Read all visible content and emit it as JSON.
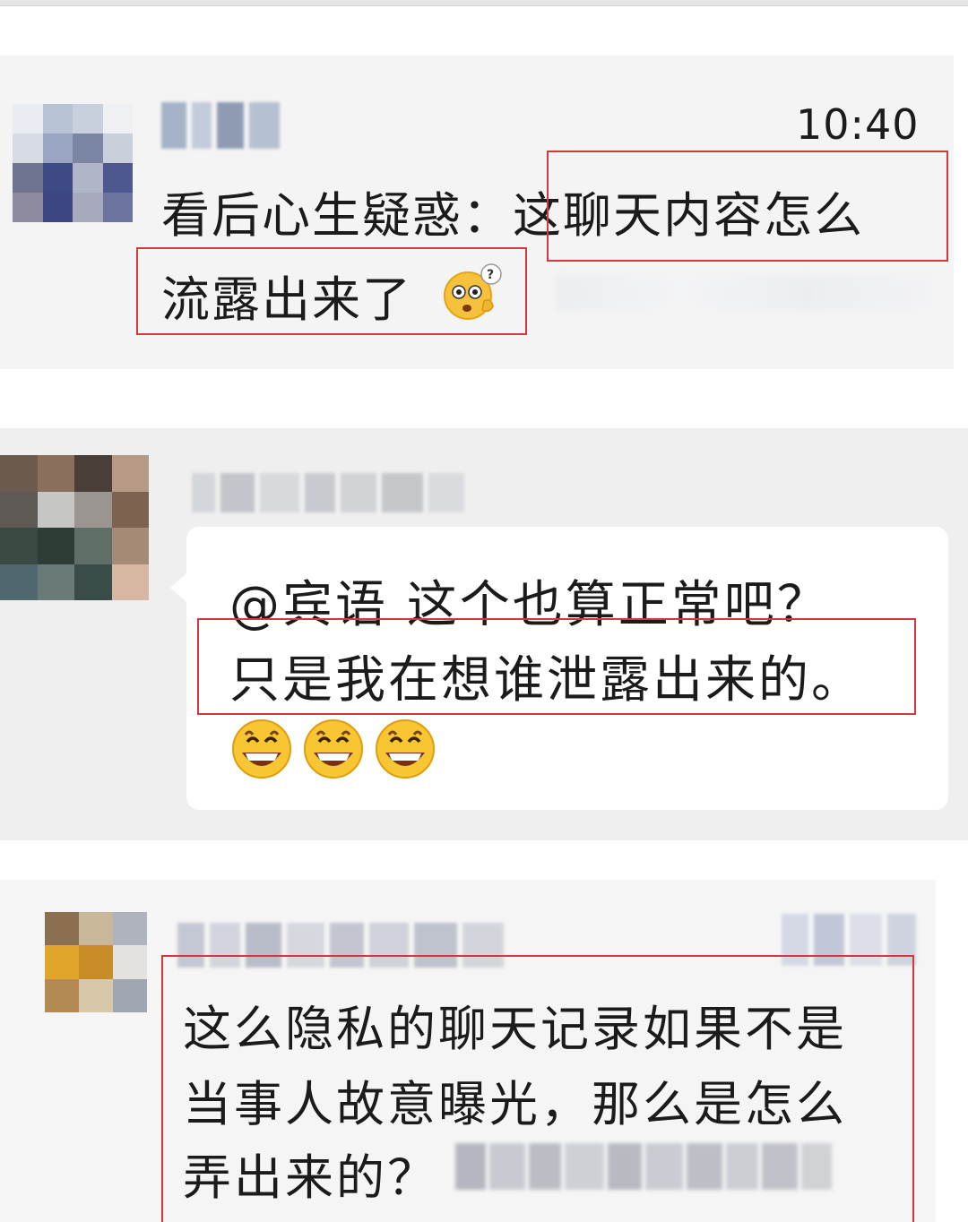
{
  "message_1": {
    "time": "10:40",
    "line1": "看后心生疑惑：这聊天内容怎么",
    "line2": "流露出来了",
    "emoji": "puzzled-face-icon"
  },
  "message_2": {
    "line1": "@宾语  这个也算正常吧？",
    "line2": "只是我在想谁泄露出来的。",
    "emoji": [
      "grinning-face-icon",
      "grinning-face-icon",
      "grinning-face-icon"
    ]
  },
  "message_3": {
    "line1": "这么隐私的聊天记录如果不是",
    "line2": "当事人故意曝光，那么是怎么",
    "line3": "弄出来的？"
  },
  "colors": {
    "highlight_box": "#d0393d",
    "timestamp": "#8d8d8d",
    "message_text": "#1b1b1b",
    "card_background": "#f4f4f4"
  }
}
